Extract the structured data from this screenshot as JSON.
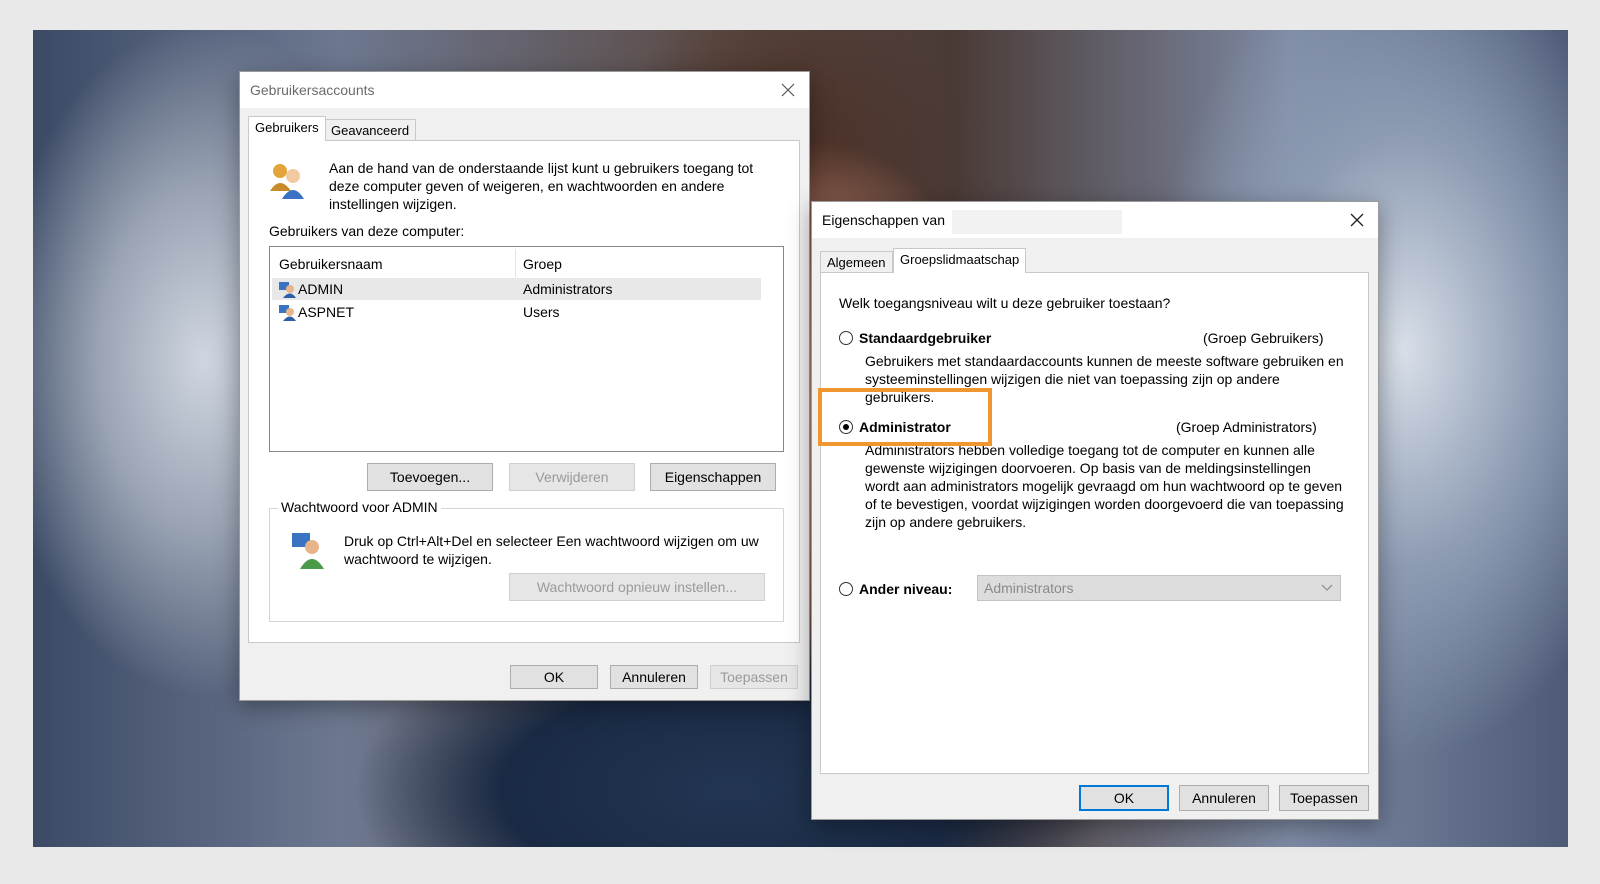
{
  "left_window": {
    "title": "Gebruikersaccounts",
    "tabs": [
      "Gebruikers",
      "Geavanceerd"
    ],
    "intro": "Aan de hand van de onderstaande lijst kunt u gebruikers toegang tot deze computer geven of weigeren, en wachtwoorden en andere instellingen wijzigen.",
    "users_label": "Gebruikers van deze computer:",
    "columns": [
      "Gebruikersnaam",
      "Groep"
    ],
    "rows": [
      {
        "name": "ADMIN",
        "group": "Administrators"
      },
      {
        "name": "ASPNET",
        "group": "Users"
      }
    ],
    "buttons": {
      "add": "Toevoegen...",
      "remove": "Verwijderen",
      "properties": "Eigenschappen"
    },
    "password_group": {
      "label": "Wachtwoord voor ADMIN",
      "text": "Druk op Ctrl+Alt+Del en selecteer Een wachtwoord wijzigen om uw wachtwoord te wijzigen.",
      "reset_button": "Wachtwoord opnieuw instellen..."
    },
    "footer": {
      "ok": "OK",
      "cancel": "Annuleren",
      "apply": "Toepassen"
    }
  },
  "right_window": {
    "title": "Eigenschappen van",
    "tabs": [
      "Algemeen",
      "Groepslidmaatschap"
    ],
    "question": "Welk toegangsniveau wilt u deze gebruiker toestaan?",
    "options": [
      {
        "label": "Standaardgebruiker",
        "group": "(Groep Gebruikers)",
        "description": "Gebruikers met standaardaccounts kunnen de meeste software gebruiken en systeeminstellingen wijzigen die niet van toepassing zijn op andere gebruikers."
      },
      {
        "label": "Administrator",
        "group": "(Groep Administrators)",
        "description": "Administrators hebben volledige toegang tot de computer en kunnen alle gewenste wijzigingen doorvoeren. Op basis van de meldingsinstellingen wordt aan administrators mogelijk gevraagd om hun wachtwoord op te geven of te bevestigen, voordat wijzigingen worden doorgevoerd die van toepassing zijn op andere gebruikers."
      }
    ],
    "other_level": {
      "label": "Ander niveau:",
      "value": "Administrators"
    },
    "footer": {
      "ok": "OK",
      "cancel": "Annuleren",
      "apply": "Toepassen"
    }
  },
  "colors": {
    "highlight": "#f0962e",
    "accent": "#0078d7"
  }
}
